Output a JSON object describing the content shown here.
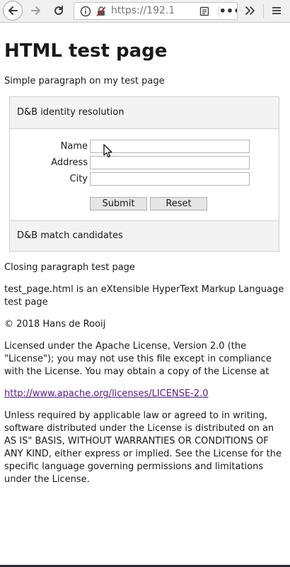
{
  "browser": {
    "url_display": "https://192.1",
    "icons": [
      "back-arrow-icon",
      "forward-arrow-icon",
      "reload-icon",
      "info-icon",
      "lock-icon",
      "reader-view-icon",
      "more-dots-icon",
      "overflow-chevrons-icon",
      "hamburger-menu-icon"
    ],
    "dots_label": "•••"
  },
  "page": {
    "title": "HTML test page",
    "intro": "Simple paragraph on my test page",
    "accordion": {
      "header": "D&B identity resolution",
      "form": {
        "name_label": "Name",
        "address_label": "Address",
        "city_label": "City",
        "name_value": "",
        "address_value": "",
        "city_value": "",
        "submit_label": "Submit",
        "reset_label": "Reset"
      },
      "footer": "D&B match candidates"
    },
    "closing": "Closing paragraph test page",
    "description": "test_page.html is an eXtensible HyperText Markup Language test page",
    "copyright": "© 2018 Hans de Rooij",
    "license": "Licensed under the Apache License, Version 2.0 (the \"License\"); you may not use this file except in compliance with the License. You may obtain a copy of the License at",
    "license_link": "http://www.apache.org/licenses/LICENSE-2.0",
    "terms": "Unless required by applicable law or agreed to in writing, software distributed under the License is distributed on an AS IS\" BASIS, WITHOUT WARRANTIES OR CONDITIONS OF ANY KIND, either express or implied. See the License for the specific language governing permissions and limitations under the License."
  },
  "colors": {
    "link_visited": "#551a8b",
    "panel_bg": "#f3f3f3",
    "toolbar_bg": "#f0f0f0"
  }
}
